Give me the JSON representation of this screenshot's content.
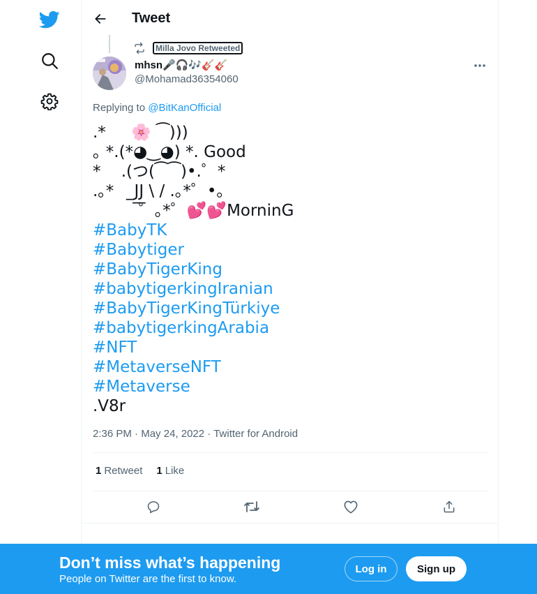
{
  "header": {
    "title": "Tweet"
  },
  "retweet": {
    "label": "Milla Jovo Retweeted"
  },
  "author": {
    "display_name": "mhsn🎤🎧🎶🎸🎸",
    "handle": "@Mohamad36354060"
  },
  "replying": {
    "prefix": "Replying to ",
    "target": "@BitKanOfficial"
  },
  "tweet": {
    "lines": [
      ".*     🌸 ⁀)))",
      "｡ *.(*◕‿◕) *. Good",
      "*    .(つ(⁀⁀)•.゜*",
      ".｡*    ̲J̲J̲ \\ / .｡*゜•｡",
      "         ゜｡*゜💕💕MorninG"
    ],
    "hashtags": [
      "#BabyTK",
      "#Babytiger",
      "#BabyTigerKing",
      "#babytigerkingIranian",
      "#BabyTigerKingTürkiye",
      "#babytigerkingArabia",
      "#NFT",
      "#MetaverseNFT",
      "#Metaverse"
    ],
    "tail": ".V8r"
  },
  "meta": {
    "time": "2:36 PM",
    "date": "May 24, 2022",
    "source": "Twitter for Android"
  },
  "stats": {
    "retweets_count": "1",
    "retweets_label": "Retweet",
    "likes_count": "1",
    "likes_label": "Like"
  },
  "banner": {
    "title": "Don’t miss what’s happening",
    "subtitle": "People on Twitter are the first to know.",
    "login_label": "Log in",
    "signup_label": "Sign up"
  },
  "colors": {
    "accent": "#1d9bf0",
    "text": "#0f1419",
    "muted": "#536471"
  },
  "icons": {
    "nav": [
      "twitter-logo-icon",
      "search-icon",
      "gear-icon"
    ],
    "actions": [
      "reply-icon",
      "retweet-icon",
      "like-icon",
      "share-icon"
    ]
  }
}
